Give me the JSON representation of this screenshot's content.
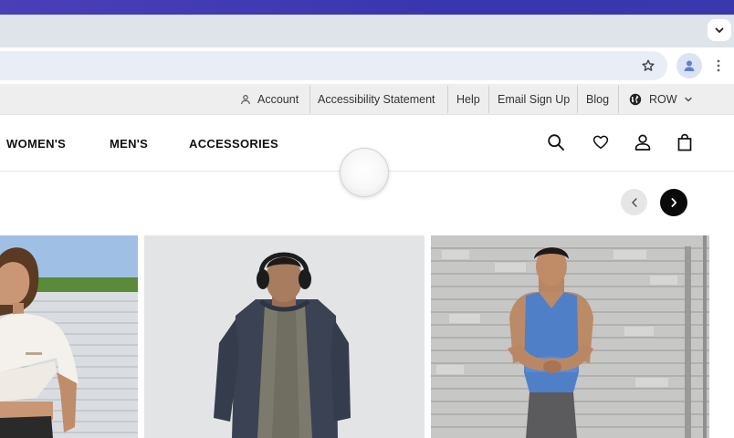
{
  "browser": {
    "tab_menu_icon": "chevron-down-icon",
    "bookmark_icon": "star-outline-icon",
    "profile_icon": "person-icon",
    "menu_icon": "kebab-icon"
  },
  "utility_bar": {
    "account_label": "Account",
    "accessibility_label": "Accessibility Statement",
    "help_label": "Help",
    "email_signup_label": "Email Sign Up",
    "blog_label": "Blog",
    "region_label": "ROW"
  },
  "main_nav": {
    "items": [
      {
        "label": "WOMEN'S"
      },
      {
        "label": "MEN'S"
      },
      {
        "label": "ACCESSORIES"
      }
    ],
    "icons": [
      "search-icon",
      "heart-icon",
      "user-icon",
      "bag-icon"
    ]
  },
  "carousel": {
    "prev_icon": "chevron-left-icon",
    "next_icon": "chevron-right-icon"
  },
  "colors": {
    "os_bar": "#4b3fb8",
    "tabstrip": "#dfe3ea",
    "omnibox": "#e9edf6",
    "utility_bar": "#eeeeee",
    "accent": "#0a0a0a"
  }
}
